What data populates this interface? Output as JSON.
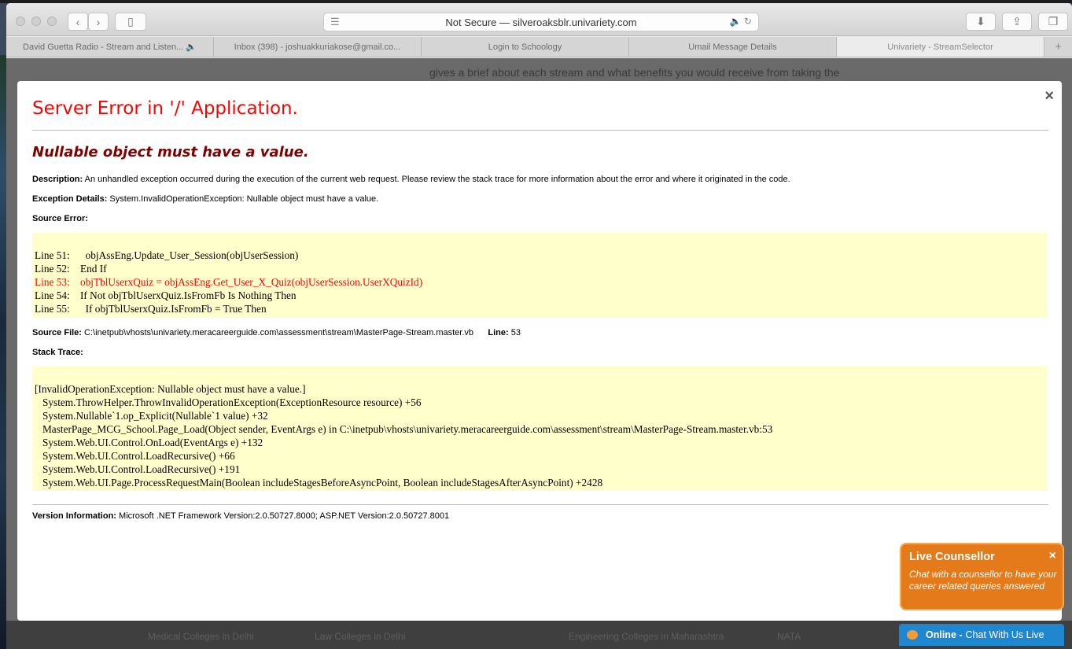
{
  "browser": {
    "url": "Not Secure — silveroaksblr.univariety.com",
    "tabs": [
      {
        "label": "David Guetta Radio - Stream and Listen... 🔈",
        "active": false
      },
      {
        "label": "Inbox (398) - joshuakkuriakose@gmail.co...",
        "active": false
      },
      {
        "label": "Login to Schoology",
        "active": false
      },
      {
        "label": "Umail Message Details",
        "active": false
      },
      {
        "label": "Univariety - StreamSelector",
        "active": true
      }
    ],
    "new_tab_symbol": "+"
  },
  "background_page": {
    "intro_text": "gives a brief about each stream and what benefits you would receive from taking the",
    "footer_links": [
      "Medical Colleges in Delhi",
      "Law Colleges in Delhi",
      "Engineering Colleges in Maharashtra",
      "NATA"
    ]
  },
  "modal": {
    "close_symbol": "×",
    "title": "Server Error in '/' Application.",
    "subtitle": "Nullable object must have a value.",
    "description_label": "Description:",
    "description": "An unhandled exception occurred during the execution of the current web request. Please review the stack trace for more information about the error and where it originated in the code.",
    "exception_label": "Exception Details:",
    "exception": "System.InvalidOperationException: Nullable object must have a value.",
    "source_error_label": "Source Error:",
    "source_lines": [
      {
        "text": "Line 51:      objAssEng.Update_User_Session(objUserSession)",
        "highlight": false
      },
      {
        "text": "Line 52:    End If",
        "highlight": false
      },
      {
        "text": "Line 53:    objTblUserxQuiz = objAssEng.Get_User_X_Quiz(objUserSession.UserXQuizId)",
        "highlight": true
      },
      {
        "text": "Line 54:    If Not objTblUserxQuiz.IsFromFb Is Nothing Then",
        "highlight": false
      },
      {
        "text": "Line 55:      If objTblUserxQuiz.IsFromFb = True Then",
        "highlight": false
      }
    ],
    "source_file_label": "Source File:",
    "source_file": "C:\\inetpub\\vhosts\\univariety.meracareerguide.com\\assessment\\stream\\MasterPage-Stream.master.vb",
    "line_label": "Line:",
    "line_number": "53",
    "stack_trace_label": "Stack Trace:",
    "stack_trace": [
      "[InvalidOperationException: Nullable object must have a value.]",
      "   System.ThrowHelper.ThrowInvalidOperationException(ExceptionResource resource) +56",
      "   System.Nullable`1.op_Explicit(Nullable`1 value) +32",
      "   MasterPage_MCG_School.Page_Load(Object sender, EventArgs e) in C:\\inetpub\\vhosts\\univariety.meracareerguide.com\\assessment\\stream\\MasterPage-Stream.master.vb:53",
      "   System.Web.UI.Control.OnLoad(EventArgs e) +132",
      "   System.Web.UI.Control.LoadRecursive() +66",
      "   System.Web.UI.Control.LoadRecursive() +191",
      "   System.Web.UI.Page.ProcessRequestMain(Boolean includeStagesBeforeAsyncPoint, Boolean includeStagesAfterAsyncPoint) +2428"
    ],
    "version_label": "Version Information:",
    "version": "Microsoft .NET Framework Version:2.0.50727.8000; ASP.NET Version:2.0.50727.8001"
  },
  "live_counsellor": {
    "title": "Live Counsellor",
    "close_symbol": "×",
    "message": "Chat with a counsellor to have your career related queries answered",
    "chat_status": "Online -",
    "chat_label": "Chat With Us Live"
  },
  "colors": {
    "error_title": "#ff0000",
    "error_subtitle": "#800000",
    "code_bg": "#ffffcc",
    "live_orange": "#e57a1b",
    "chat_blue": "#1f86d0"
  }
}
